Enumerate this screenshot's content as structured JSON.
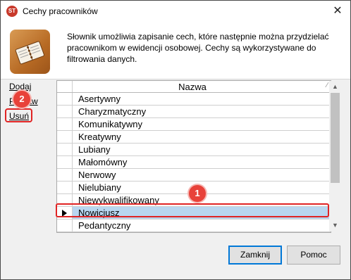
{
  "window": {
    "title": "Cechy pracowników",
    "close_glyph": "✕",
    "app_icon_label": "ST"
  },
  "header": {
    "description": "Słownik umożliwia zapisanie cech, które następnie można przydzielać pracownikom w ewidencji osobowej. Cechy są wykorzystywane do filtrowania danych."
  },
  "side_actions": {
    "add": "Dodaj",
    "edit": "Popraw",
    "delete": "Usuń"
  },
  "grid": {
    "column_header": "Nazwa",
    "sort_glyph": "∕",
    "rows": [
      "Asertywny",
      "Charyzmatyczny",
      "Komunikatywny",
      "Kreatywny",
      "Lubiany",
      "Małomówny",
      "Nerwowy",
      "Nielubiany",
      "Niewykwalifikowany",
      "Nowicjusz",
      "Pedantyczny"
    ],
    "selected_row": "Nowicjusz"
  },
  "annotations": {
    "badge_1": "1",
    "badge_2": "2"
  },
  "buttons": {
    "close": "Zamknij",
    "help": "Pomoc"
  },
  "colors": {
    "selection": "#b8d6f0",
    "annotation_red": "#e02424",
    "primary_border": "#0078d7"
  }
}
